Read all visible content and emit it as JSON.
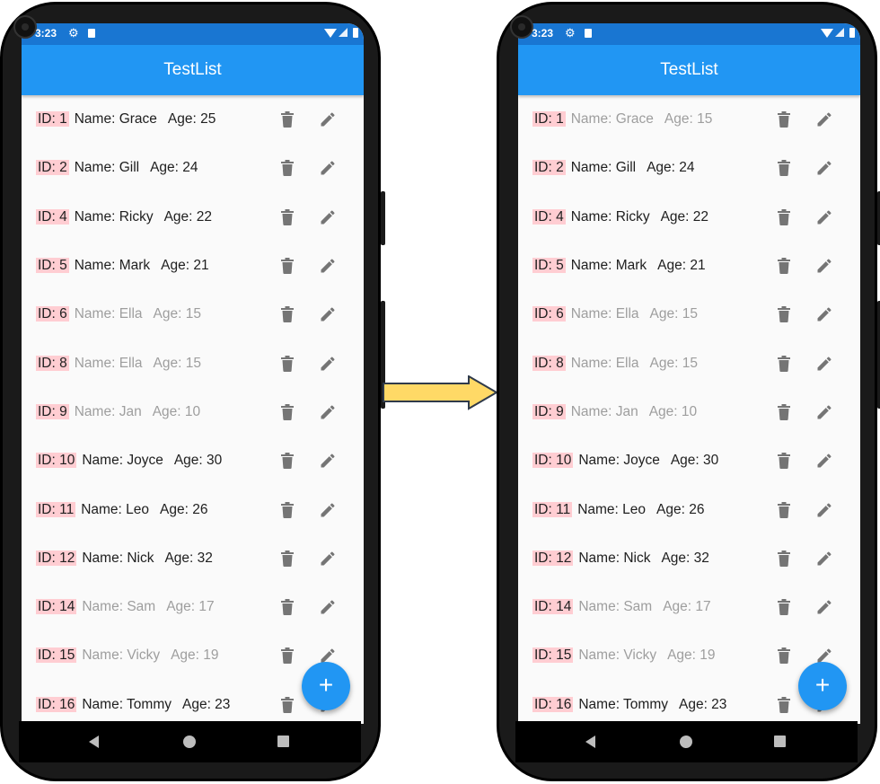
{
  "status": {
    "time": "3:23"
  },
  "app": {
    "title": "TestList",
    "fab_label": "+"
  },
  "colors": {
    "appbar": "#2196f3",
    "statusbar": "#1976d2",
    "id_badge": "#ffcdd2",
    "faded_text": "#9e9e9e",
    "icon": "#757575",
    "arrow_fill": "#ffd966"
  },
  "icons": {
    "delete": "trash-icon",
    "edit": "pencil-icon",
    "settings": "gear-icon",
    "add": "plus-icon"
  },
  "left_list": [
    {
      "id": "ID: 1",
      "name": "Name: Grace",
      "age": "Age: 25",
      "faded": false
    },
    {
      "id": "ID: 2",
      "name": "Name: Gill",
      "age": "Age: 24",
      "faded": false
    },
    {
      "id": "ID: 4",
      "name": "Name: Ricky",
      "age": "Age: 22",
      "faded": false
    },
    {
      "id": "ID: 5",
      "name": "Name: Mark",
      "age": "Age: 21",
      "faded": false
    },
    {
      "id": "ID: 6",
      "name": "Name: Ella",
      "age": "Age: 15",
      "faded": true
    },
    {
      "id": "ID: 8",
      "name": "Name: Ella",
      "age": "Age: 15",
      "faded": true
    },
    {
      "id": "ID: 9",
      "name": "Name: Jan",
      "age": "Age: 10",
      "faded": true
    },
    {
      "id": "ID: 10",
      "name": "Name: Joyce",
      "age": "Age: 30",
      "faded": false
    },
    {
      "id": "ID: 11",
      "name": "Name: Leo",
      "age": "Age: 26",
      "faded": false
    },
    {
      "id": "ID: 12",
      "name": "Name: Nick",
      "age": "Age: 32",
      "faded": false
    },
    {
      "id": "ID: 14",
      "name": "Name: Sam",
      "age": "Age: 17",
      "faded": true
    },
    {
      "id": "ID: 15",
      "name": "Name: Vicky",
      "age": "Age: 19",
      "faded": true
    },
    {
      "id": "ID: 16",
      "name": "Name: Tommy",
      "age": "Age: 23",
      "faded": false
    }
  ],
  "right_list": [
    {
      "id": "ID: 1",
      "name": "Name: Grace",
      "age": "Age: 15",
      "faded": true
    },
    {
      "id": "ID: 2",
      "name": "Name: Gill",
      "age": "Age: 24",
      "faded": false
    },
    {
      "id": "ID: 4",
      "name": "Name: Ricky",
      "age": "Age: 22",
      "faded": false
    },
    {
      "id": "ID: 5",
      "name": "Name: Mark",
      "age": "Age: 21",
      "faded": false
    },
    {
      "id": "ID: 6",
      "name": "Name: Ella",
      "age": "Age: 15",
      "faded": true
    },
    {
      "id": "ID: 8",
      "name": "Name: Ella",
      "age": "Age: 15",
      "faded": true
    },
    {
      "id": "ID: 9",
      "name": "Name: Jan",
      "age": "Age: 10",
      "faded": true
    },
    {
      "id": "ID: 10",
      "name": "Name: Joyce",
      "age": "Age: 30",
      "faded": false
    },
    {
      "id": "ID: 11",
      "name": "Name: Leo",
      "age": "Age: 26",
      "faded": false
    },
    {
      "id": "ID: 12",
      "name": "Name: Nick",
      "age": "Age: 32",
      "faded": false
    },
    {
      "id": "ID: 14",
      "name": "Name: Sam",
      "age": "Age: 17",
      "faded": true
    },
    {
      "id": "ID: 15",
      "name": "Name: Vicky",
      "age": "Age: 19",
      "faded": true
    },
    {
      "id": "ID: 16",
      "name": "Name: Tommy",
      "age": "Age: 23",
      "faded": false
    }
  ]
}
